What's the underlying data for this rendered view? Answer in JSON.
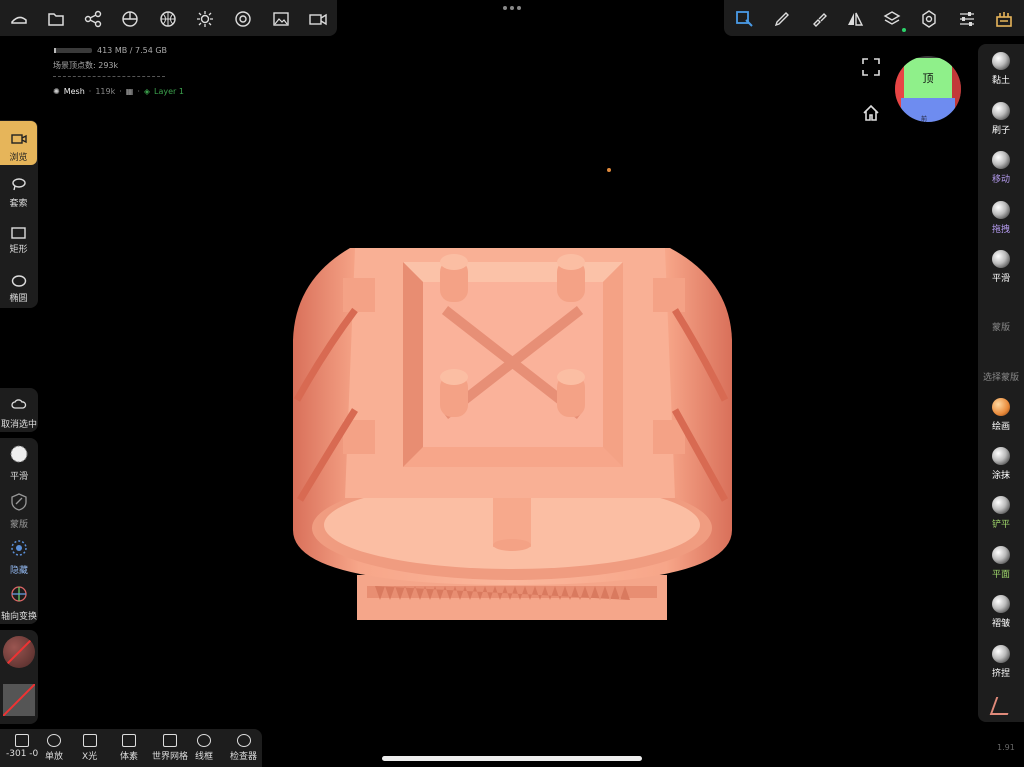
{
  "stats": {
    "memory": "413 MB / 7.54 GB",
    "vertex_count": "场景顶点数: 293k",
    "mesh_name": "Mesh",
    "mesh_count": "119k",
    "layer": "Layer 1"
  },
  "top_toolbar_left": [
    "files-icon",
    "folder-icon",
    "scene-share-icon",
    "material-icon",
    "background-icon",
    "light-icon",
    "shading-icon",
    "image-icon",
    "video-icon"
  ],
  "top_toolbar_right": [
    "selection-icon",
    "brush-icon",
    "paint-icon",
    "symmetry-icon",
    "layers-icon",
    "settings-icon",
    "sliders-icon",
    "app-icon"
  ],
  "view_cube": {
    "face": "顶",
    "bottom": "前"
  },
  "left_tools": [
    {
      "label": "浏览",
      "icon": "camera-icon",
      "active": true
    },
    {
      "label": "套索",
      "icon": "lasso-icon"
    },
    {
      "label": "矩形",
      "icon": "rectangle-icon"
    },
    {
      "label": "椭圆",
      "icon": "ellipse-icon"
    }
  ],
  "left_actions": [
    {
      "label": "取消选中",
      "icon": "cloud-icon"
    }
  ],
  "left_tools2": [
    {
      "label": "平滑",
      "icon": "smooth-icon"
    },
    {
      "label": "蒙版",
      "icon": "mask-icon"
    },
    {
      "label": "隐藏",
      "icon": "hide-icon"
    },
    {
      "label": "轴向变换",
      "icon": "gizmo-icon"
    }
  ],
  "right_tools": [
    {
      "label": "黏土",
      "color": "#ffffff"
    },
    {
      "label": "刷子",
      "color": "#ffffff"
    },
    {
      "label": "移动",
      "color": "#b59cf0"
    },
    {
      "label": "拖拽",
      "color": "#b59cf0"
    },
    {
      "label": "平滑",
      "color": "#ffffff"
    },
    {
      "label": "蒙版",
      "color": "#888888"
    },
    {
      "label": "选择蒙版",
      "color": "#888888"
    },
    {
      "label": "绘画",
      "color": "#ffffff"
    },
    {
      "label": "涂抹",
      "color": "#ffffff"
    },
    {
      "label": "铲平",
      "color": "#9fd66b"
    },
    {
      "label": "平面",
      "color": "#9fd66b"
    },
    {
      "label": "褶皱",
      "color": "#ffffff"
    },
    {
      "label": "挤捏",
      "color": "#ffffff"
    }
  ],
  "bottom_bar": [
    {
      "label": "-301 -0",
      "icon": "history-icon"
    },
    {
      "label": "单放",
      "icon": "zoom-icon"
    },
    {
      "label": "X光",
      "icon": "xray-icon"
    },
    {
      "label": "体素",
      "icon": "voxel-icon"
    },
    {
      "label": "世界网格",
      "icon": "grid-icon"
    },
    {
      "label": "线框",
      "icon": "wireframe-icon"
    },
    {
      "label": "检查器",
      "icon": "inspector-icon"
    }
  ],
  "version": "1.91",
  "colors": {
    "accent": "#e6b55a",
    "ring": "#f4a98a",
    "panel": "#1d1d1d"
  }
}
